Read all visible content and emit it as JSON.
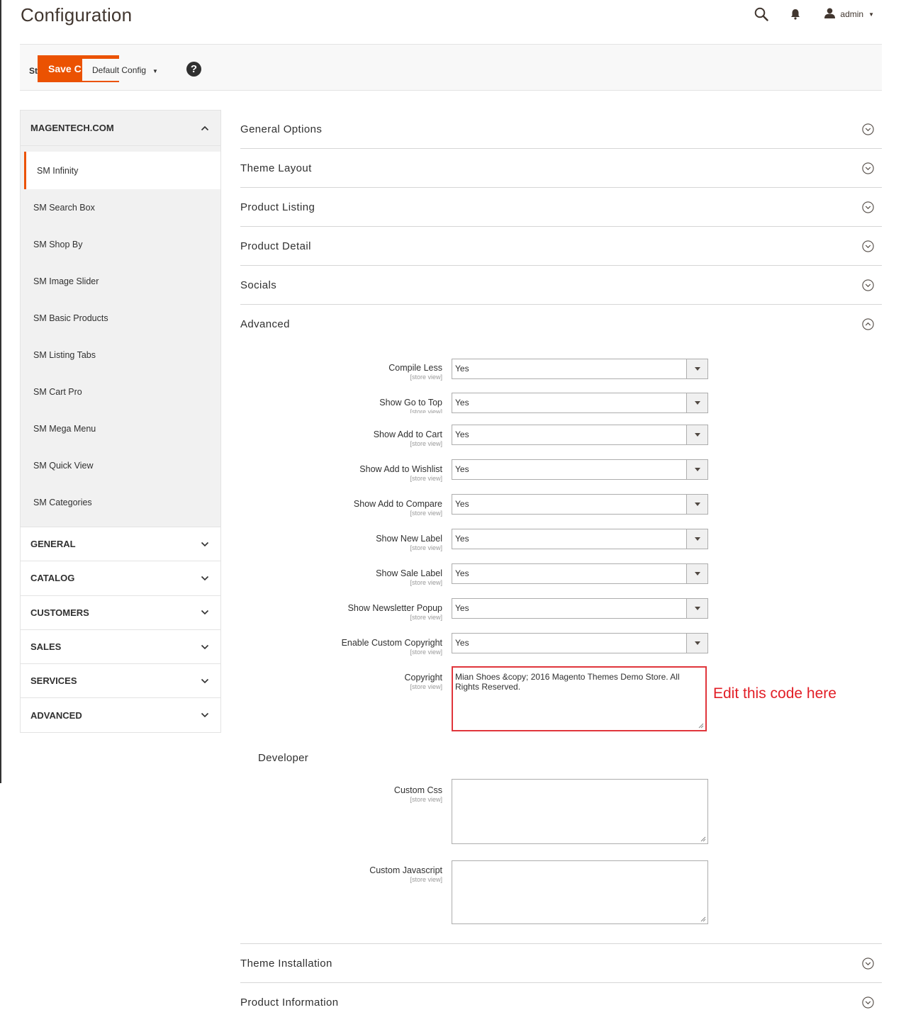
{
  "page": {
    "title": "Configuration"
  },
  "header": {
    "user_name": "admin"
  },
  "toolbar": {
    "scope_label": "St",
    "save_label": "Save C",
    "scope_value": "Default Config",
    "help": "?"
  },
  "sidebar": {
    "group_title": "MAGENTECH.COM",
    "items": [
      {
        "label": "SM Infinity",
        "active": true
      },
      {
        "label": "SM Search Box"
      },
      {
        "label": "SM Shop By"
      },
      {
        "label": "SM Image Slider"
      },
      {
        "label": "SM Basic Products"
      },
      {
        "label": "SM Listing Tabs"
      },
      {
        "label": "SM Cart Pro"
      },
      {
        "label": "SM Mega Menu"
      },
      {
        "label": "SM Quick View"
      },
      {
        "label": "SM Categories"
      }
    ],
    "sections": [
      "GENERAL",
      "CATALOG",
      "CUSTOMERS",
      "SALES",
      "SERVICES",
      "ADVANCED"
    ]
  },
  "main": {
    "sections": [
      "General Options",
      "Theme Layout",
      "Product Listing",
      "Product Detail",
      "Socials",
      "Advanced"
    ],
    "advanced": {
      "scope_note": "[store view]",
      "fields": [
        {
          "label": "Compile Less",
          "value": "Yes"
        },
        {
          "label": "Show Go to Top",
          "value": "Yes"
        },
        {
          "label": "Show Add to Cart",
          "value": "Yes"
        },
        {
          "label": "Show Add to Wishlist",
          "value": "Yes"
        },
        {
          "label": "Show Add to Compare",
          "value": "Yes"
        },
        {
          "label": "Show New Label",
          "value": "Yes"
        },
        {
          "label": "Show Sale Label",
          "value": "Yes"
        },
        {
          "label": "Show Newsletter Popup",
          "value": "Yes"
        },
        {
          "label": "Enable Custom Copyright",
          "value": "Yes"
        }
      ],
      "copyright": {
        "label": "Copyright",
        "value": "Mian Shoes &copy; 2016 Magento Themes Demo Store. All Rights Reserved."
      },
      "annotation": "Edit this code here",
      "developer_heading": "Developer",
      "custom_css": {
        "label": "Custom Css",
        "value": ""
      },
      "custom_js": {
        "label": "Custom Javascript",
        "value": ""
      }
    },
    "bottom_sections": [
      "Theme Installation",
      "Product Information"
    ]
  },
  "colors": {
    "accent": "#eb5202",
    "annotation": "#e21e26",
    "highlight_border": "#e0353b"
  },
  "icons": [
    "search-icon",
    "bell-icon",
    "user-icon",
    "help-icon",
    "chevron-up-icon",
    "chevron-down-icon",
    "circle-chevron-down-icon",
    "circle-chevron-up-icon"
  ]
}
